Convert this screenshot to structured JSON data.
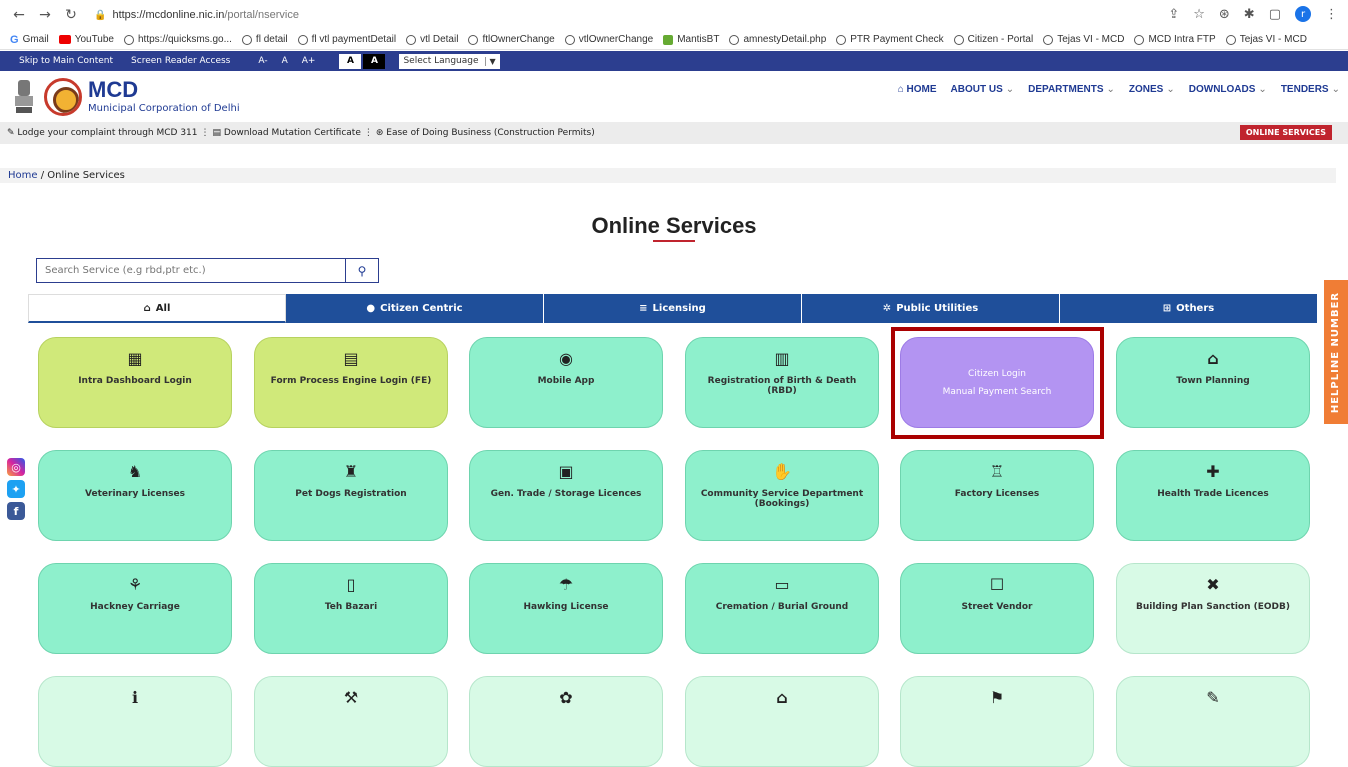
{
  "browser": {
    "url_host": "https://mcdonline.nic.in",
    "url_path": "/portal/nservice",
    "profile_initial": "r",
    "bookmarks": [
      "Gmail",
      "YouTube",
      "https://quicksms.go...",
      "fl detail",
      "fl vtl paymentDetail",
      "vtl Detail",
      "ftlOwnerChange",
      "vtlOwnerChange",
      "MantisBT",
      "amnestyDetail.php",
      "PTR Payment Check",
      "Citizen - Portal",
      "Tejas VI - MCD",
      "MCD Intra FTP",
      "Tejas VI - MCD"
    ]
  },
  "access": {
    "skip": "Skip to Main Content",
    "reader": "Screen Reader Access",
    "font_minus": "A-",
    "font_normal": "A",
    "font_plus": "A+",
    "contrast_light": "A",
    "contrast_dark": "A",
    "language": "Select Language"
  },
  "header": {
    "title": "MCD",
    "subtitle": "Municipal Corporation of Delhi",
    "nav": [
      "HOME",
      "ABOUT US",
      "DEPARTMENTS",
      "ZONES",
      "DOWNLOADS",
      "TENDERS"
    ]
  },
  "quick_links": {
    "items": [
      "Lodge your complaint through MCD 311",
      "Download Mutation Certificate",
      "Ease of Doing Business (Construction Permits)"
    ],
    "online_services": "ONLINE SERVICES"
  },
  "breadcrumb": {
    "home": "Home",
    "sep": " / ",
    "current": "Online Services"
  },
  "page": {
    "title": "Online Services"
  },
  "search": {
    "placeholder": "Search Service (e.g rbd,ptr etc.)"
  },
  "tabs": [
    "All",
    "Citizen Centric",
    "Licensing",
    "Public Utilities",
    "Others"
  ],
  "helpline": "HELPLINE NUMBER",
  "cards": [
    {
      "label": "Intra Dashboard Login",
      "style": "yellow",
      "icon": "dashboard-icon"
    },
    {
      "label": "Form Process Engine Login (FE)",
      "style": "yellow",
      "icon": "form-icon"
    },
    {
      "label": "Mobile App",
      "style": "green",
      "icon": "mobile-app-icon"
    },
    {
      "label": "Registration of Birth & Death (RBD)",
      "style": "green",
      "icon": "document-icon"
    },
    {
      "label": "Citizen Login",
      "label2": "Manual Payment Search",
      "style": "purple",
      "icon": ""
    },
    {
      "label": "Town Planning",
      "style": "green",
      "icon": "town-icon"
    },
    {
      "label": "Veterinary Licenses",
      "style": "green",
      "icon": "vet-icon"
    },
    {
      "label": "Pet Dogs Registration",
      "style": "green",
      "icon": "dog-icon"
    },
    {
      "label": "Gen. Trade / Storage Licences",
      "style": "green",
      "icon": "trade-icon"
    },
    {
      "label": "Community Service Department (Bookings)",
      "style": "green",
      "icon": "handshake-icon"
    },
    {
      "label": "Factory Licenses",
      "style": "green",
      "icon": "factory-icon"
    },
    {
      "label": "Health Trade Licences",
      "style": "green",
      "icon": "health-icon"
    },
    {
      "label": "Hackney Carriage",
      "style": "green",
      "icon": "carriage-icon"
    },
    {
      "label": "Teh Bazari",
      "style": "green",
      "icon": "bazari-icon"
    },
    {
      "label": "Hawking License",
      "style": "green",
      "icon": "hawking-icon"
    },
    {
      "label": "Cremation / Burial Ground",
      "style": "green",
      "icon": "cremation-icon"
    },
    {
      "label": "Street Vendor",
      "style": "green",
      "icon": "vendor-icon"
    },
    {
      "label": "Building Plan Sanction (EODB)",
      "style": "pale",
      "icon": "building-icon"
    },
    {
      "label": "",
      "style": "pale",
      "icon": "info-icon"
    },
    {
      "label": "",
      "style": "pale",
      "icon": "worker-icon"
    },
    {
      "label": "",
      "style": "pale",
      "icon": "plant-icon"
    },
    {
      "label": "",
      "style": "pale",
      "icon": "house-icon"
    },
    {
      "label": "",
      "style": "pale",
      "icon": "tax-icon"
    },
    {
      "label": "",
      "style": "pale",
      "icon": "edit-icon"
    }
  ]
}
